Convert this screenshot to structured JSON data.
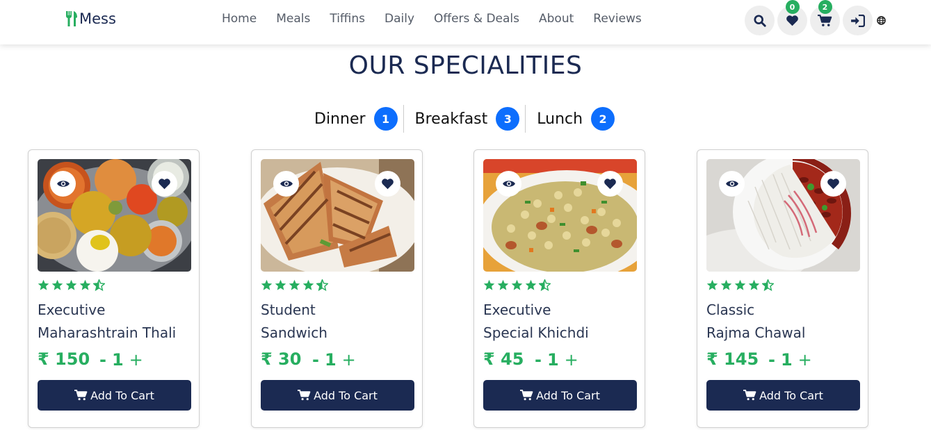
{
  "brand": {
    "name": "Mess"
  },
  "nav": {
    "links": [
      "Home",
      "Meals",
      "Tiffins",
      "Daily",
      "Offers & Deals",
      "About",
      "Reviews"
    ]
  },
  "icons": {
    "wishlist_count": "0",
    "cart_count": "2"
  },
  "section": {
    "title": "OUR SPECIALITIES"
  },
  "tabs": [
    {
      "label": "Dinner",
      "count": "1"
    },
    {
      "label": "Breakfast",
      "count": "3"
    },
    {
      "label": "Lunch",
      "count": "2"
    }
  ],
  "products": [
    {
      "line1": "Executive",
      "line2": "Maharashtrain Thali",
      "price": "₹ 150",
      "qty": "1",
      "rating": 4.5,
      "cart_label": "Add To Cart"
    },
    {
      "line1": "Student",
      "line2": "Sandwich",
      "price": "₹ 30",
      "qty": "1",
      "rating": 4.5,
      "cart_label": "Add To Cart"
    },
    {
      "line1": "Executive",
      "line2": "Special Khichdi",
      "price": "₹ 45",
      "qty": "1",
      "rating": 4.5,
      "cart_label": "Add To Cart"
    },
    {
      "line1": "Classic",
      "line2": "Rajma Chawal",
      "price": "₹ 145",
      "qty": "1",
      "rating": 4.5,
      "cart_label": "Add To Cart"
    }
  ],
  "qty_controls": {
    "minus": "-",
    "plus": "+"
  },
  "colors": {
    "navy": "#1b2a52",
    "green": "#27ae60",
    "blue": "#0d6efd"
  }
}
